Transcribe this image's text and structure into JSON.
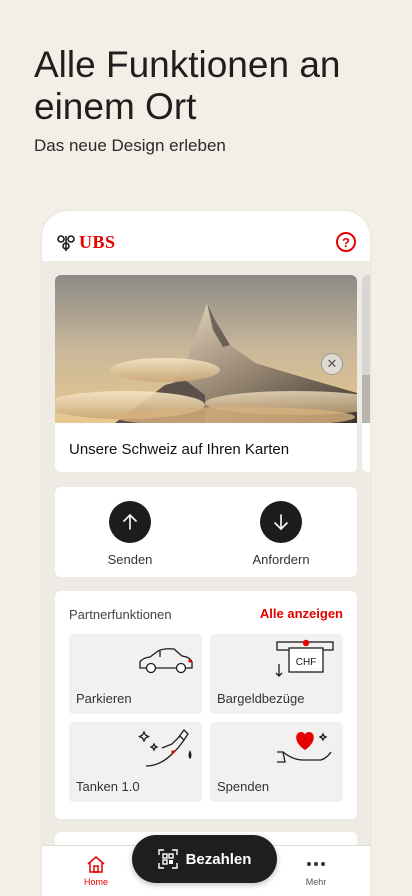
{
  "promo": {
    "title": "Alle Funktionen an einem Ort",
    "subtitle": "Das neue Design erleben"
  },
  "header": {
    "brand": "UBS",
    "help_label": "?"
  },
  "hero": {
    "caption": "Unsere Schweiz auf Ihren Karten",
    "close_symbol": "✕"
  },
  "actions": {
    "send_label": "Senden",
    "request_label": "Anfordern"
  },
  "partners": {
    "title": "Partnerfunktionen",
    "show_all": "Alle anzeigen",
    "tiles": [
      {
        "label": "Parkieren",
        "icon": "car-icon"
      },
      {
        "label": "Bargeldbezüge",
        "icon": "atm-chf-icon",
        "art_text": "CHF"
      },
      {
        "label": "Tanken 1.0",
        "icon": "fuel-pump-icon"
      },
      {
        "label": "Spenden",
        "icon": "heart-hand-icon"
      }
    ]
  },
  "tabbar": {
    "home": "Home",
    "pay": "Bezahlen",
    "more": "Mehr"
  },
  "colors": {
    "accent": "#e60000",
    "background": "#f3efe6",
    "dark": "#1c1c1c"
  }
}
